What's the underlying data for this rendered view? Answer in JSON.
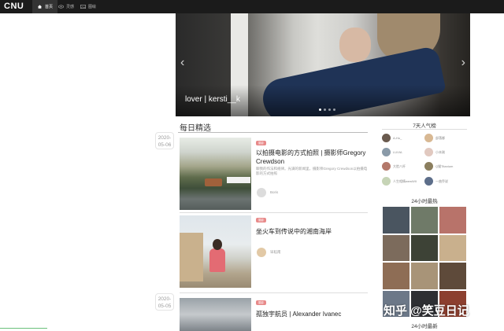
{
  "logo": "CNU",
  "nav": [
    {
      "label": "首页",
      "icon": "home-icon"
    },
    {
      "label": "灵感",
      "icon": "eye-icon"
    },
    {
      "label": "图绘",
      "icon": "image-icon"
    }
  ],
  "hero": {
    "caption": "lover | kersti__k",
    "slides_total": 4,
    "slide_active": 1
  },
  "daily": {
    "title": "每日精选",
    "dates": [
      {
        "line1": "2020-",
        "line2": "05-06"
      },
      {
        "line1": "2020-",
        "line2": "05-05"
      }
    ],
    "cards": [
      {
        "tag": "摄影",
        "title": "以拍摄电影的方式拍照 | 摄影师Gregory Crewdson",
        "desc": "聊我的作法和规律。光满的新闻里，摄影师Gregory Crewdson以拍摄电影的方式拍照",
        "author": "Boris"
      },
      {
        "tag": "摄影",
        "title": "坐火车到传说中的湘南海岸",
        "desc": "",
        "author": "早稻南"
      },
      {
        "tag": "摄影",
        "title": "孤独宇航员 | Alexander Ivanec",
        "desc": "",
        "author": ""
      }
    ]
  },
  "sidebar": {
    "popular_title": "7天人气榜",
    "popular": [
      {
        "name": "A-Ho_"
      },
      {
        "name": "部落娜"
      },
      {
        "name": "LUVIA"
      },
      {
        "name": "小本刚"
      },
      {
        "name": "大脸八杆"
      },
      {
        "name": "Q猫Titanium"
      },
      {
        "name": "人生相情wewWII"
      },
      {
        "name": "一曲乔说"
      }
    ],
    "hot_title": "24小时最热",
    "new_title": "24小时最新"
  },
  "watermark": "知乎 @笑豆日记",
  "colors": {
    "topbar": "#1b1b1b",
    "tag": "#e88a8a"
  }
}
